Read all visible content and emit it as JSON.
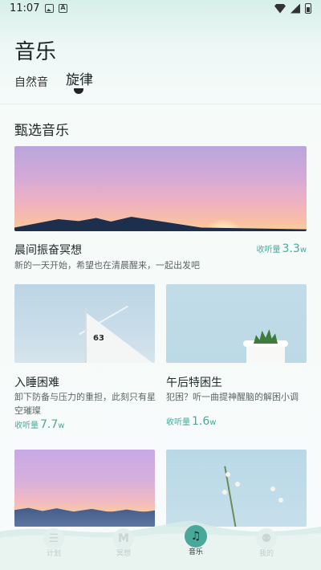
{
  "status": {
    "time": "11:07"
  },
  "header": {
    "title": "音乐"
  },
  "tabs": [
    {
      "label": "自然音"
    },
    {
      "label": "旋律"
    }
  ],
  "section": {
    "title": "甄选音乐"
  },
  "cards": [
    {
      "title": "晨间振奋冥想",
      "desc": "新的一天开始，希望也在清晨醒来，一起出发吧",
      "listen_label": "收听量",
      "listen_value": "3.3",
      "listen_unit": "w"
    },
    {
      "title": "入睡困难",
      "desc": "卸下防备与压力的重担，此刻只有星空璀璨",
      "listen_label": "收听量",
      "listen_value": "7.7",
      "listen_unit": "w",
      "image_text": "63"
    },
    {
      "title": "午后特困生",
      "desc": "犯困？听一曲提神醒脑的解困小调",
      "listen_label": "收听量",
      "listen_value": "1.6",
      "listen_unit": "w"
    }
  ],
  "nav": [
    {
      "label": "计划",
      "icon": "list-icon",
      "glyph": "☰"
    },
    {
      "label": "冥想",
      "icon": "meditation-icon",
      "glyph": "M"
    },
    {
      "label": "音乐",
      "icon": "music-note-icon",
      "glyph": "♫"
    },
    {
      "label": "我的",
      "icon": "profile-icon",
      "glyph": "⚉"
    }
  ],
  "colors": {
    "accent": "#4aa89a",
    "title": "#1b2624"
  }
}
